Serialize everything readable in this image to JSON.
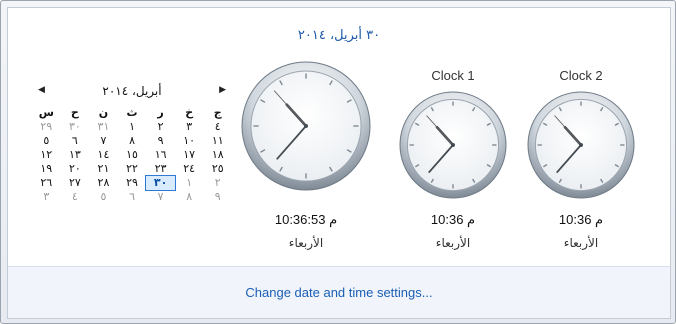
{
  "header": {
    "date": "٣٠ أبريل، ٢٠١٤"
  },
  "calendar": {
    "title": "أبريل، ٢٠١٤",
    "prev_icon": "left-arrow-icon",
    "next_icon": "right-arrow-icon",
    "days_of_week": [
      "س",
      "ح",
      "ن",
      "ث",
      "ر",
      "خ",
      "ج"
    ],
    "weeks": [
      [
        "٢٩",
        "٣٠",
        "٣١",
        "١",
        "٢",
        "٣",
        "٤"
      ],
      [
        "٥",
        "٦",
        "٧",
        "٨",
        "٩",
        "١٠",
        "١١"
      ],
      [
        "١٢",
        "١٣",
        "١٤",
        "١٥",
        "١٦",
        "١٧",
        "١٨"
      ],
      [
        "١٩",
        "٢٠",
        "٢١",
        "٢٢",
        "٢٣",
        "٢٤",
        "٢٥"
      ],
      [
        "٢٦",
        "٢٧",
        "٢٨",
        "٢٩",
        "٣٠",
        "١",
        "٢"
      ],
      [
        "٣",
        "٤",
        "٥",
        "٦",
        "٧",
        "٨",
        "٩"
      ]
    ],
    "today": "٣٠"
  },
  "clocks": [
    {
      "title": "",
      "time": "10:36:53 م",
      "day": "الأربعاء",
      "hour": 10,
      "minute": 36,
      "second": 53
    },
    {
      "title": "Clock 1",
      "time": "10:36 م",
      "day": "الأربعاء",
      "hour": 10,
      "minute": 36,
      "second": 53
    },
    {
      "title": "Clock 2",
      "time": "10:36 م",
      "day": "الأربعاء",
      "hour": 10,
      "minute": 36,
      "second": 53
    }
  ],
  "footer": {
    "link": "Change date and time settings..."
  },
  "colors": {
    "accent": "#1e5aa8",
    "link": "#1a5fb4"
  }
}
